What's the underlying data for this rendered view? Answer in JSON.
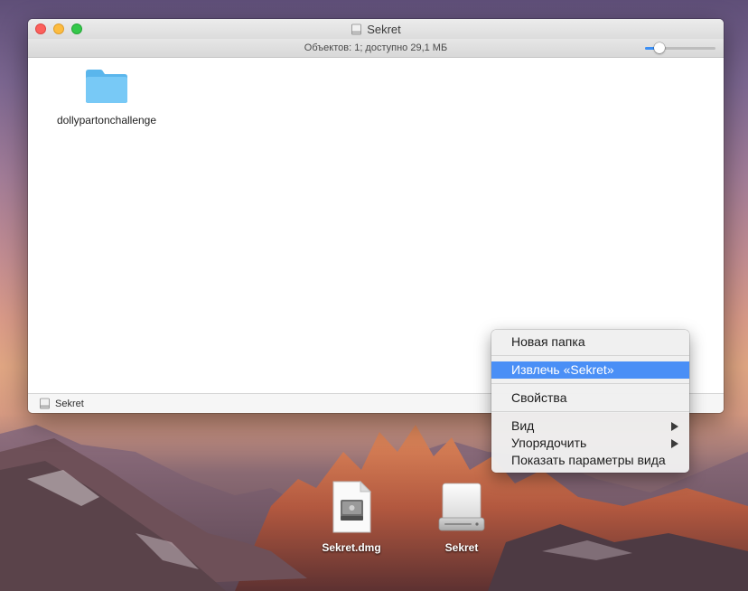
{
  "window": {
    "title": "Sekret",
    "status": "Объектов: 1; доступно 29,1 МБ",
    "icon_size_slider": 0.2,
    "items": [
      {
        "label": "dollypartonchallenge",
        "icon": "folder-icon"
      }
    ],
    "pathbar_label": "Sekret"
  },
  "context_menu": {
    "items": [
      {
        "label": "Новая папка"
      },
      {
        "label": "Извлечь «Sekret»",
        "highlighted": true
      },
      {
        "label": "Свойства"
      },
      {
        "label": "Вид",
        "submenu": true
      },
      {
        "label": "Упорядочить",
        "submenu": true
      },
      {
        "label": "Показать параметры вида"
      }
    ]
  },
  "desktop": {
    "icons": [
      {
        "label": "Sekret.dmg",
        "icon": "dmg-file-icon"
      },
      {
        "label": "Sekret",
        "icon": "external-disk-icon"
      }
    ]
  },
  "colors": {
    "menu_highlight": "#4a8ff6",
    "traffic_close": "#fc605c",
    "traffic_minimize": "#fdbc40",
    "traffic_zoom": "#34c84a",
    "folder_blue": "#6cc4f5"
  }
}
